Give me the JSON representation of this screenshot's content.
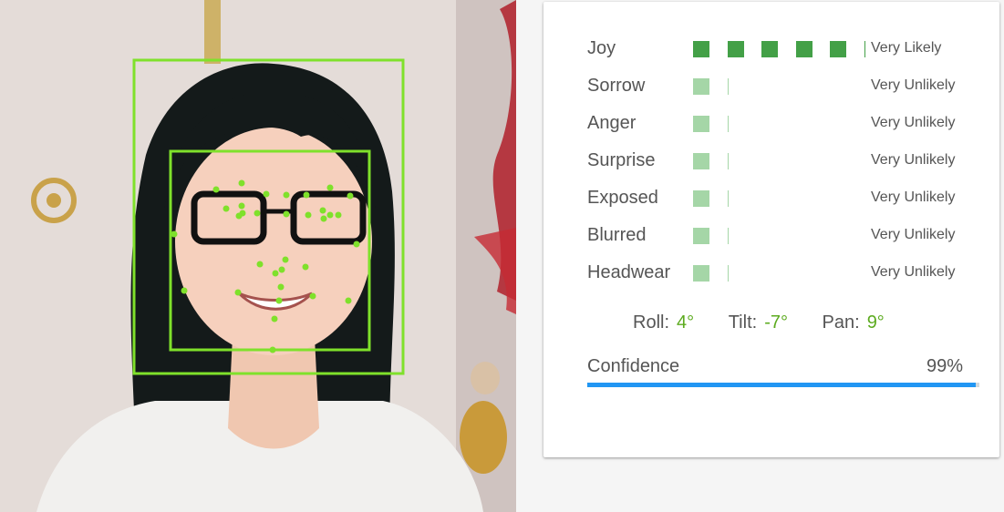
{
  "photo": {
    "alt": "face photo",
    "face_box_color": "#7fe12b",
    "landmark_color": "#7fe12b"
  },
  "emotions": [
    {
      "label": "Joy",
      "value": "Very Likely",
      "level": 5
    },
    {
      "label": "Sorrow",
      "value": "Very Unlikely",
      "level": 1
    },
    {
      "label": "Anger",
      "value": "Very Unlikely",
      "level": 1
    },
    {
      "label": "Surprise",
      "value": "Very Unlikely",
      "level": 1
    },
    {
      "label": "Exposed",
      "value": "Very Unlikely",
      "level": 1
    },
    {
      "label": "Blurred",
      "value": "Very Unlikely",
      "level": 1
    },
    {
      "label": "Headwear",
      "value": "Very Unlikely",
      "level": 1
    }
  ],
  "angles": {
    "roll_label": "Roll:",
    "roll": "4°",
    "tilt_label": "Tilt:",
    "tilt": "-7°",
    "pan_label": "Pan:",
    "pan": "9°"
  },
  "confidence": {
    "label": "Confidence",
    "value": "99%",
    "fraction": 0.99
  },
  "colors": {
    "likely_box": "#43a047",
    "unlikely_box": "#a5d6a7",
    "angle_value": "#5cab1f",
    "confidence_bar": "#2196f3"
  }
}
